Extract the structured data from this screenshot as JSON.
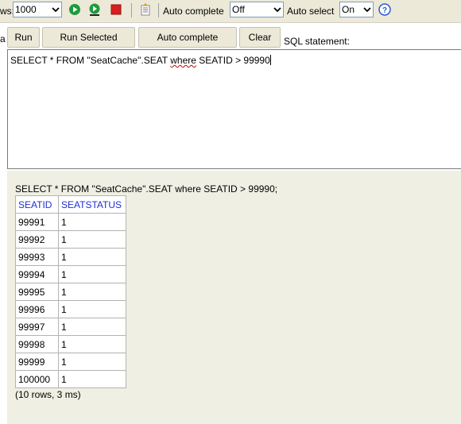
{
  "toolbar": {
    "rows_label_fragment": "ws:",
    "max_rows_value": "1000",
    "auto_complete_label": "Auto complete",
    "auto_complete_value": "Off",
    "auto_select_label": "Auto select",
    "auto_select_value": "On",
    "icons": [
      "run-icon",
      "run-selected-icon",
      "stop-icon",
      "history-icon",
      "help-icon"
    ]
  },
  "buttons": {
    "run": "Run",
    "run_selected": "Run Selected",
    "auto_complete": "Auto complete",
    "clear": "Clear"
  },
  "sql_label": "SQL statement:",
  "editor": {
    "before": "SELECT * FROM \"SeatCache\".SEAT ",
    "underlined": "where",
    "after": " SEATID > 99990"
  },
  "results": {
    "echo": "SELECT * FROM \"SeatCache\".SEAT where SEATID > 99990;",
    "columns": [
      "SEATID",
      "SEATSTATUS"
    ],
    "rows": [
      [
        "99991",
        "1"
      ],
      [
        "99992",
        "1"
      ],
      [
        "99993",
        "1"
      ],
      [
        "99994",
        "1"
      ],
      [
        "99995",
        "1"
      ],
      [
        "99996",
        "1"
      ],
      [
        "99997",
        "1"
      ],
      [
        "99998",
        "1"
      ],
      [
        "99999",
        "1"
      ],
      [
        "100000",
        "1"
      ]
    ],
    "summary": "(10 rows, 3 ms)"
  },
  "colors": {
    "header_text": "#1f2ed6",
    "results_bg": "#f0efe3",
    "toolbar_bg": "#ece9d8",
    "run_icon": "#1e9a3c",
    "stop_icon": "#d81e1e"
  }
}
